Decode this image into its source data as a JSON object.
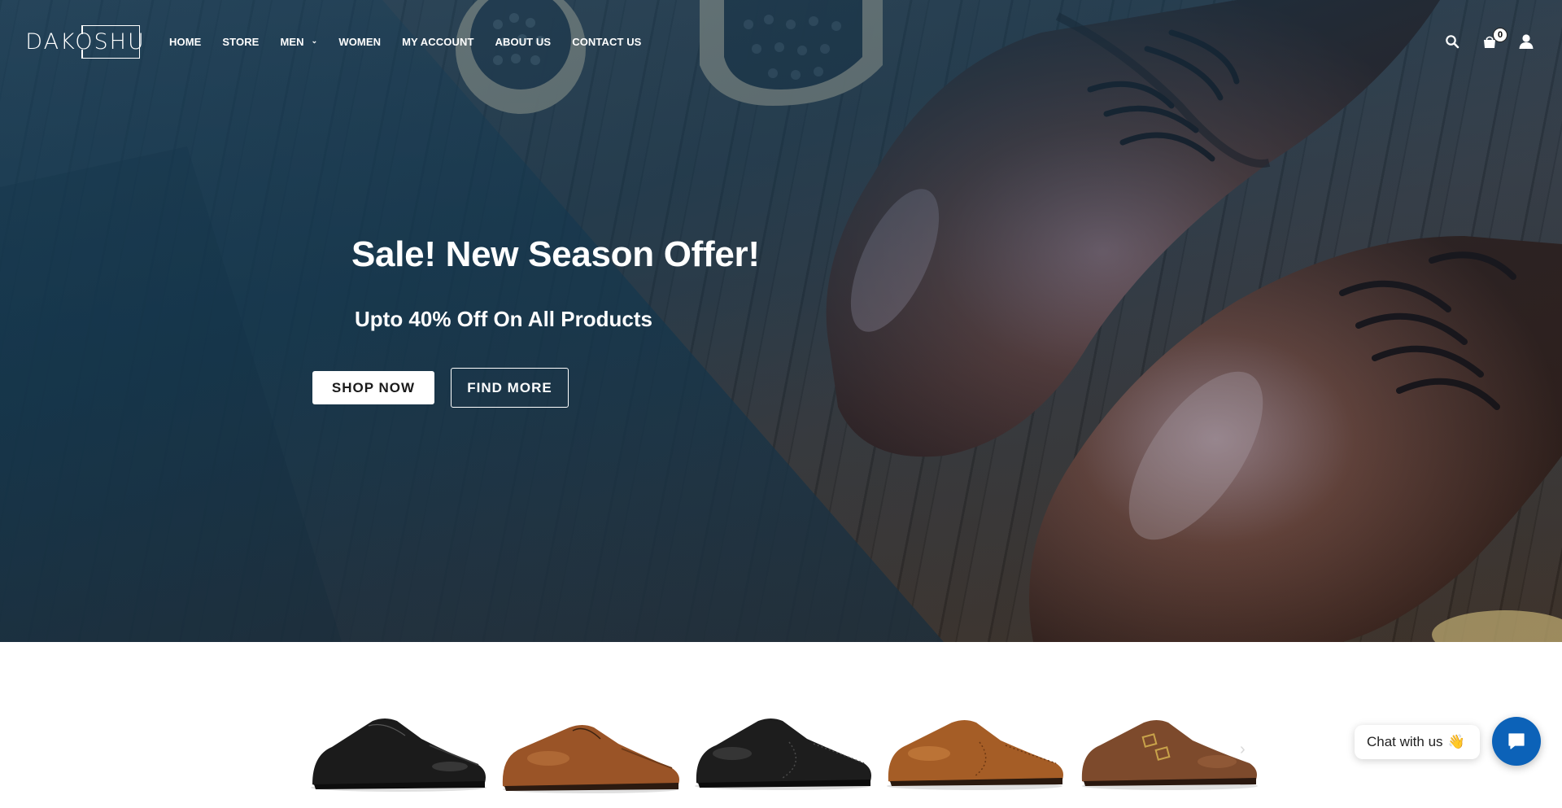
{
  "brand": {
    "logo_text": "DAKOSHU"
  },
  "nav": {
    "items": [
      {
        "label": "HOME"
      },
      {
        "label": "STORE"
      },
      {
        "label": "MEN",
        "has_dropdown": true
      },
      {
        "label": "WOMEN"
      },
      {
        "label": "MY ACCOUNT"
      },
      {
        "label": "ABOUT US"
      },
      {
        "label": "CONTACT US"
      }
    ]
  },
  "header_icons": {
    "search": "search-icon",
    "cart": "shopping-bag-icon",
    "cart_count": "0",
    "account": "user-icon"
  },
  "hero": {
    "title": "Sale! New Season Offer!",
    "subtitle": "Upto 40% Off On All Products",
    "primary_button": "SHOP NOW",
    "secondary_button": "FIND MORE"
  },
  "carousel": {
    "prev_icon": "chevron-left-icon",
    "next_icon": "chevron-right-icon",
    "products": [
      {
        "name": "black-cap-toe-oxford",
        "color": "#1b1b1b"
      },
      {
        "name": "tan-cap-toe-oxford",
        "color": "#9a5427"
      },
      {
        "name": "black-wingtip-oxford",
        "color": "#1d1d1d"
      },
      {
        "name": "tan-wingtip-brogue",
        "color": "#a55d26"
      },
      {
        "name": "brown-double-monk-strap",
        "color": "#7d4a2c"
      }
    ]
  },
  "chat": {
    "label": "Chat with us",
    "emoji": "👋",
    "button_icon": "chat-bubble-icon",
    "accent": "#0c62b8"
  }
}
